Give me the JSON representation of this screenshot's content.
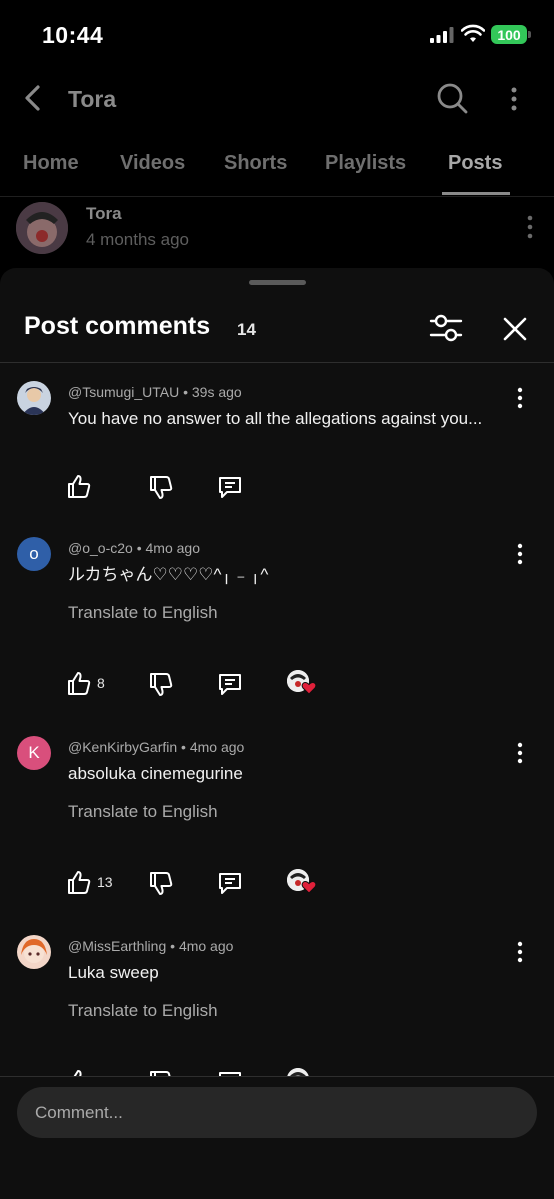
{
  "status": {
    "time": "10:44",
    "battery": "100"
  },
  "header": {
    "title": "Tora"
  },
  "tabs": [
    {
      "label": "Home"
    },
    {
      "label": "Videos"
    },
    {
      "label": "Shorts"
    },
    {
      "label": "Playlists"
    },
    {
      "label": "Posts",
      "active": true
    }
  ],
  "post": {
    "author": "Tora",
    "time": "4 months ago"
  },
  "sheet": {
    "title": "Post comments",
    "count": "14"
  },
  "comments": [
    {
      "handle": "@Tsumugi_UTAU",
      "age": "39s ago",
      "text": "You have no answer to all the allegations against you...",
      "translate": "",
      "likes": "",
      "creator_heart": false
    },
    {
      "handle": "@o_o-c2o",
      "age": "4mo ago",
      "avatar_letter": "o",
      "text": "ルカちゃん♡♡♡♡^╷ ₋ ╷^",
      "translate": "Translate to English",
      "likes": "8",
      "creator_heart": true
    },
    {
      "handle": "@KenKirbyGarfin",
      "age": "4mo ago",
      "avatar_letter": "K",
      "text": "absoluka cinemegurine",
      "translate": "Translate to English",
      "likes": "13",
      "creator_heart": true
    },
    {
      "handle": "@MissEarthling",
      "age": "4mo ago",
      "text": "Luka sweep",
      "translate": "Translate to English",
      "likes": "",
      "creator_heart": true
    }
  ],
  "meta_sep": "•",
  "input": {
    "placeholder": "Comment..."
  },
  "colors": {
    "avatar_blue": "#2f5fa8",
    "avatar_pink": "#d94f7c",
    "heart_red": "#e0203a",
    "battery_green": "#33c759"
  },
  "icons": [
    "back-icon",
    "search-icon",
    "more-vert-icon",
    "filter-icon",
    "close-icon",
    "thumb-up-icon",
    "thumb-down-icon",
    "reply-icon",
    "heart-icon"
  ]
}
